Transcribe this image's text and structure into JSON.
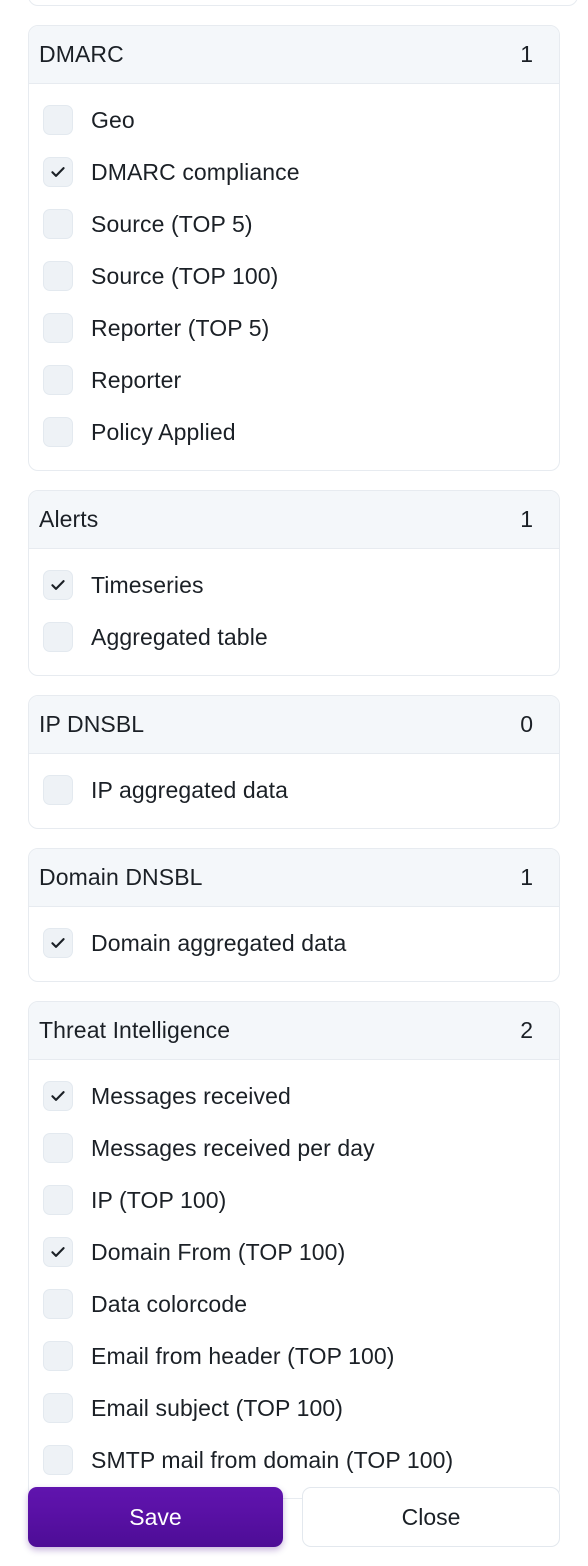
{
  "dialog": {
    "groups": [
      {
        "title": "DMARC",
        "count": "1",
        "options": [
          {
            "label": "Geo",
            "checked": false
          },
          {
            "label": "DMARC compliance",
            "checked": true
          },
          {
            "label": "Source (TOP 5)",
            "checked": false
          },
          {
            "label": "Source (TOP 100)",
            "checked": false
          },
          {
            "label": "Reporter (TOP 5)",
            "checked": false
          },
          {
            "label": "Reporter",
            "checked": false
          },
          {
            "label": "Policy Applied",
            "checked": false
          }
        ]
      },
      {
        "title": "Alerts",
        "count": "1",
        "options": [
          {
            "label": "Timeseries",
            "checked": true
          },
          {
            "label": "Aggregated table",
            "checked": false
          }
        ]
      },
      {
        "title": "IP DNSBL",
        "count": "0",
        "options": [
          {
            "label": "IP aggregated data",
            "checked": false
          }
        ]
      },
      {
        "title": "Domain DNSBL",
        "count": "1",
        "options": [
          {
            "label": "Domain aggregated data",
            "checked": true
          }
        ]
      },
      {
        "title": "Threat Intelligence",
        "count": "2",
        "options": [
          {
            "label": "Messages received",
            "checked": true
          },
          {
            "label": "Messages received per day",
            "checked": false
          },
          {
            "label": "IP (TOP 100)",
            "checked": false
          },
          {
            "label": "Domain From (TOP 100)",
            "checked": true
          },
          {
            "label": "Data colorcode",
            "checked": false
          },
          {
            "label": "Email from header (TOP 100)",
            "checked": false
          },
          {
            "label": "Email subject (TOP 100)",
            "checked": false
          },
          {
            "label": "SMTP mail from domain (TOP 100)",
            "checked": false
          }
        ]
      }
    ],
    "footer": {
      "save_label": "Save",
      "close_label": "Close"
    }
  },
  "colors": {
    "accent": "#5a11a6",
    "card_border": "#e7ebf0",
    "header_bg": "#f4f7fa",
    "checkbox_bg": "#eef2f6",
    "text": "#1b2026"
  },
  "icons": {
    "checkmark": "check-icon"
  }
}
